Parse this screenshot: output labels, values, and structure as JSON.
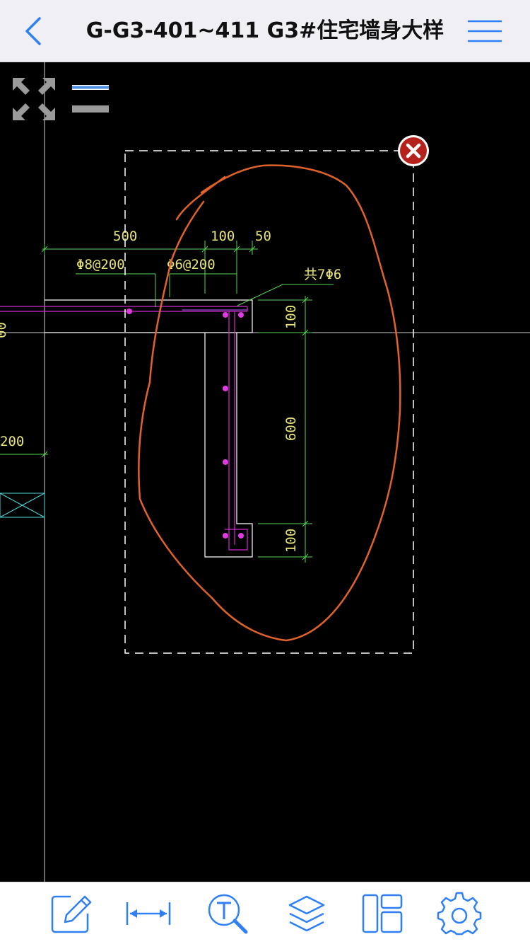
{
  "app": {
    "title": "G-G3-401~411 G3#住宅墙身大样",
    "accent_color": "#2f7ff5"
  },
  "toolbar": {
    "buttons": [
      {
        "name": "annotate",
        "icon": "pencil-edit-icon"
      },
      {
        "name": "measure",
        "icon": "dimension-arrow-icon"
      },
      {
        "name": "text-search",
        "icon": "text-search-icon"
      },
      {
        "name": "layers",
        "icon": "layers-icon"
      },
      {
        "name": "layout",
        "icon": "layout-panels-icon"
      },
      {
        "name": "settings",
        "icon": "gear-icon"
      }
    ]
  },
  "drawing": {
    "dim_500": "500",
    "dim_100_top": "100",
    "dim_50": "50",
    "rebar_phi8": "Φ8@200",
    "rebar_phi6": "Φ6@200",
    "rebar_total": "共7Φ6",
    "dim_100_right_top": "100",
    "dim_600": "600",
    "dim_100_right_bottom": "100",
    "left_partial_200": "200",
    "left_partial_00": "00"
  },
  "colors": {
    "cad_text": "#e8e47a",
    "dimension_line": "#55d655",
    "outline": "#ffffff",
    "rebar": "#d12bd1",
    "markup_stroke": "#e0622a",
    "close_button": "#b5211b"
  }
}
